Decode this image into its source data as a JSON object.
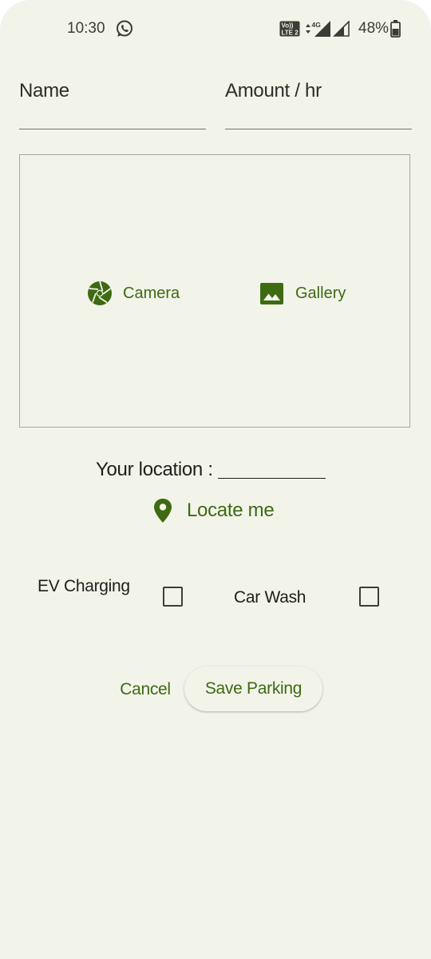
{
  "status_bar": {
    "time": "10:30",
    "whatsapp_icon": "whatsapp-icon",
    "volte_label_top": "Vo)) ",
    "volte_label_bottom": "LTE 2",
    "network_label": "4G",
    "battery_percent": "48%"
  },
  "form": {
    "name_label": "Name",
    "amount_label": "Amount / hr"
  },
  "image_picker": {
    "camera_label": "Camera",
    "camera_icon": "camera-shutter-icon",
    "gallery_label": "Gallery",
    "gallery_icon": "image-icon"
  },
  "location": {
    "label": "Your location :",
    "locate_label": "Locate me",
    "locate_icon": "map-pin-icon"
  },
  "amenities": {
    "ev_label": "EV Charging",
    "ev_checked": false,
    "wash_label": "Car Wash",
    "wash_checked": false
  },
  "actions": {
    "cancel_label": "Cancel",
    "save_label": "Save Parking"
  },
  "colors": {
    "background": "#f2f4ea",
    "accent": "#3e6a12",
    "text": "#1d1f1b",
    "outline": "#a4a99c"
  }
}
